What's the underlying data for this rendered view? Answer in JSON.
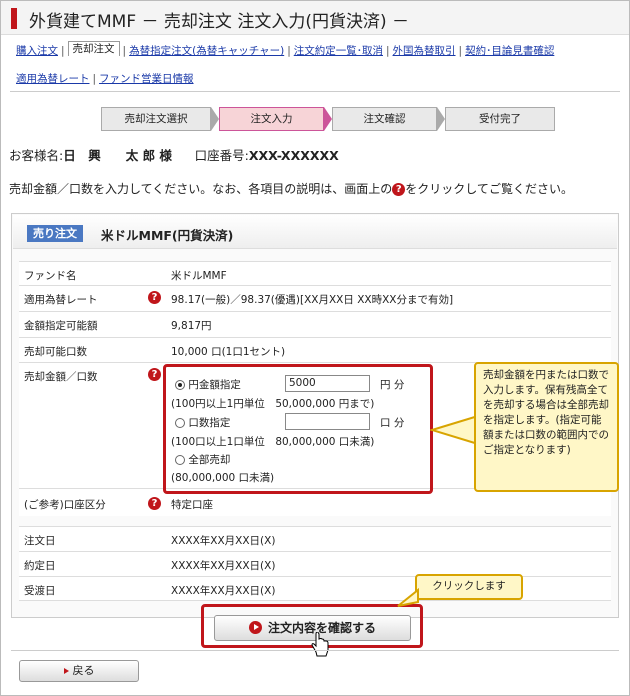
{
  "page_title": "外貨建てMMF － 売却注文 注文入力(円貨決済) －",
  "nav": {
    "tab1": "購入注文",
    "tab_active": "売却注文",
    "link3": "為替指定注文(為替キャッチャー)",
    "link4": "注文約定一覧･取消",
    "link5": "外国為替取引",
    "link6": "契約･目論見書確認",
    "link7": "適用為替レート",
    "link8": "ファンド営業日情報"
  },
  "steps": [
    "売却注文選択",
    "注文入力",
    "注文確認",
    "受付完了"
  ],
  "customer": {
    "name_label": "お客様名:",
    "name": "日　興　　太 郎 様",
    "account_label": "口座番号:",
    "account": "XXX-XXXXXX"
  },
  "instruction": {
    "pre": "売却金額／口数を入力してください。なお、各項目の説明は、画面上の",
    "post": "をクリックしてご覧ください。"
  },
  "panel": {
    "badge": "売り注文",
    "title": "米ドルMMF(円貨決済)"
  },
  "rows": {
    "fund_label": "ファンド名",
    "fund_value": "米ドルMMF",
    "rate_label": "適用為替レート",
    "rate_value": "98.17(一般)／98.37(優遇)[XX月XX日 XX時XX分まで有効]",
    "amount_label": "金額指定可能額",
    "amount_value": "9,817円",
    "units_label": "売却可能口数",
    "units_value": "10,000 口(1口1セント)",
    "sell_label": "売却金額／口数",
    "yen_option": "円金額指定",
    "yen_value": "5000",
    "yen_unit": "円 分",
    "yen_note": "(100円以上1円単位　50,000,000 円まで)",
    "unit_option": "口数指定",
    "unit_unit": "口 分",
    "unit_note": "(100口以上1口単位　80,000,000 口未満)",
    "all_option": "全部売却",
    "all_note": "(80,000,000 口未満)",
    "acct_label": "(ご参考)口座区分",
    "acct_value": "特定口座",
    "order_date_label": "注文日",
    "order_date": "XXXX年XX月XX日(X)",
    "contract_label": "約定日",
    "contract_date": "XXXX年XX月XX日(X)",
    "delivery_label": "受渡日",
    "delivery_date": "XXXX年XX月XX日(X)"
  },
  "callout_text": "売却金額を円または口数で入力します。保有残高全てを売却する場合は全部売却を指定します。(指定可能額または口数の範囲内でのご指定となります)",
  "callout_click": "クリックします",
  "buttons": {
    "confirm": "注文内容を確認する",
    "back": "戻る"
  }
}
